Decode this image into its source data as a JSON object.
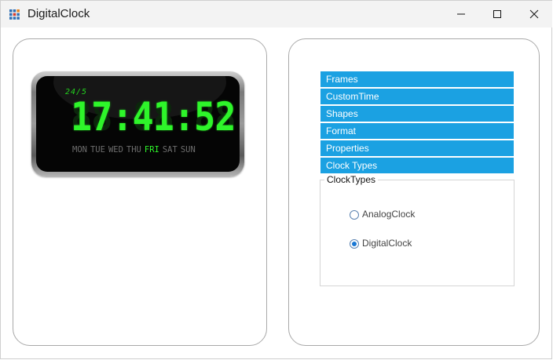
{
  "window": {
    "title": "DigitalClock"
  },
  "clock": {
    "date_label": "24/5",
    "time": "17:41:52",
    "ghost": "88:88:88",
    "days": [
      "MON",
      "TUE",
      "WED",
      "THU",
      "FRI",
      "SAT",
      "SUN"
    ],
    "active_day": "FRI",
    "digit_color": "#2ef52a"
  },
  "menu": {
    "items": [
      "Frames",
      "CustomTime",
      "Shapes",
      "Format",
      "Properties",
      "Clock Types"
    ],
    "background": "#1ba1e2"
  },
  "clock_types": {
    "label": "ClockTypes",
    "options": [
      "AnalogClock",
      "DigitalClock"
    ],
    "selected": "DigitalClock"
  }
}
